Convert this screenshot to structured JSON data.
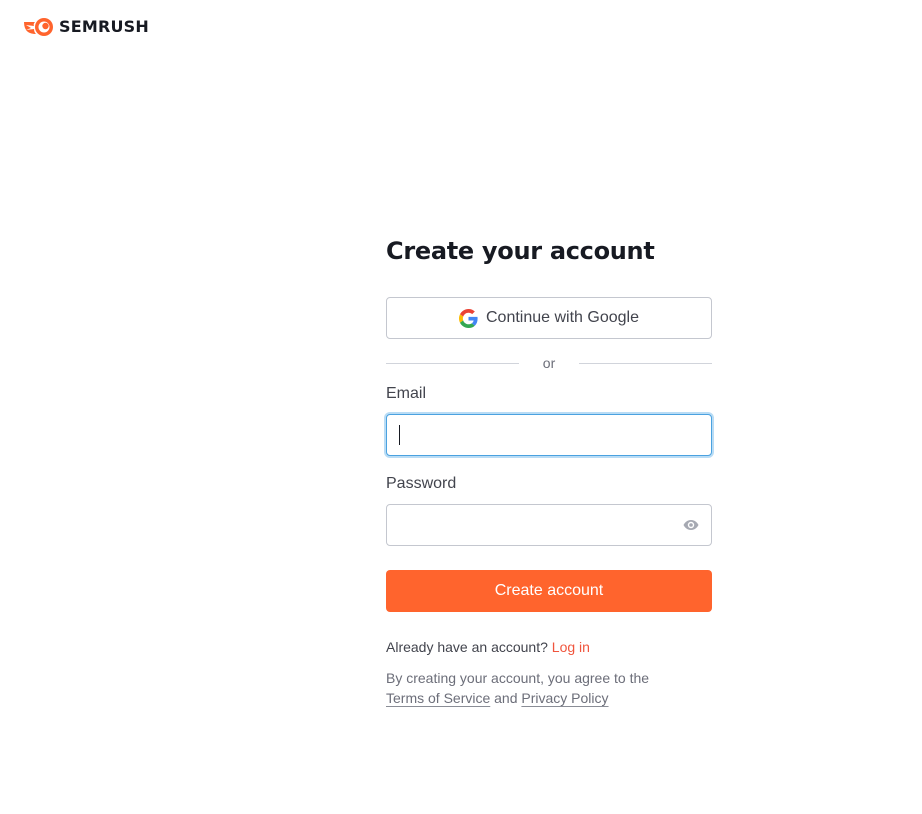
{
  "brand": {
    "name": "SEMRUSH",
    "accent_color": "#ff642d"
  },
  "form": {
    "title": "Create your account",
    "google_button_label": "Continue with Google",
    "divider_text": "or",
    "email": {
      "label": "Email",
      "value": "",
      "placeholder": ""
    },
    "password": {
      "label": "Password",
      "value": "",
      "placeholder": "",
      "toggle_icon": "eye-icon"
    },
    "submit_label": "Create account",
    "login_prompt": "Already have an account?",
    "login_link": "Log in",
    "terms_prefix": "By creating your account, you agree to the",
    "terms_link": "Terms of Service",
    "terms_and": "and",
    "privacy_link": "Privacy Policy"
  }
}
